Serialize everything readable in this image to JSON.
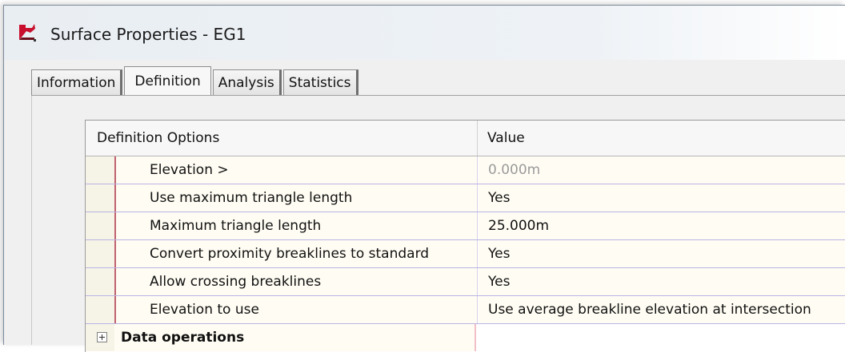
{
  "window": {
    "title": "Surface Properties - EG1"
  },
  "tabs": [
    {
      "label": "Information",
      "active": false
    },
    {
      "label": "Definition",
      "active": true
    },
    {
      "label": "Analysis",
      "active": false
    },
    {
      "label": "Statistics",
      "active": false
    }
  ],
  "grid": {
    "columns": [
      "Definition Options",
      "Value"
    ],
    "rows": [
      {
        "name": "Elevation >",
        "value": "0.000m",
        "dim": true
      },
      {
        "name": "Use maximum triangle length",
        "value": "Yes"
      },
      {
        "name": "Maximum triangle length",
        "value": "25.000m"
      },
      {
        "name": "Convert proximity breaklines to standard",
        "value": "Yes"
      },
      {
        "name": "Allow crossing breaklines",
        "value": "Yes"
      },
      {
        "name": "Elevation to use",
        "value": "Use average breakline elevation at intersection"
      }
    ],
    "group": {
      "name": "Data operations"
    }
  },
  "icons": {
    "app": "civil3d-surface-icon",
    "expander": "plus-expander-icon"
  },
  "colors": {
    "gutter_line": "#c06070",
    "row_line": "#b9b3e4",
    "cell_bg": "#fffdf3"
  }
}
